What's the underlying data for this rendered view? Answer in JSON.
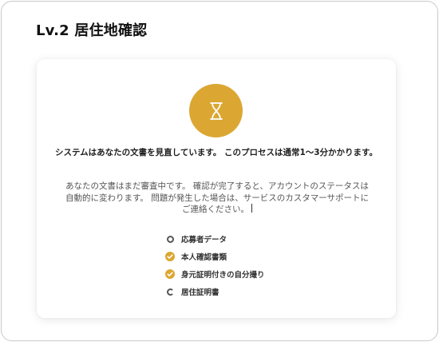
{
  "page": {
    "title": "Lv.2 居住地確認"
  },
  "card": {
    "status_icon": "hourglass-icon",
    "headline": "システムはあなたの文書を見直しています。 このプロセスは通常1〜3分かかります。",
    "description": "あなたの文書はまだ審査中です。 確認が完了すると、アカウントのステータスは自動的に変わります。 問題が発生した場合は、サービスのカスタマーサポートにご連絡ください。"
  },
  "steps": [
    {
      "label": "応募者データ",
      "status": "pending"
    },
    {
      "label": "本人確認書類",
      "status": "done"
    },
    {
      "label": "身元証明付きの自分撮り",
      "status": "done"
    },
    {
      "label": "居住証明書",
      "status": "pending"
    }
  ],
  "colors": {
    "accent": "#dba732",
    "text_dark": "#1e1e1e",
    "text_muted": "#555555",
    "card_bg": "#ffffff"
  }
}
